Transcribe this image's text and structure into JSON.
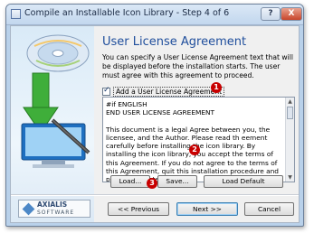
{
  "window": {
    "title": "Compile an Installable Icon Library - Step 4 of 6",
    "help_label": "?",
    "close_label": "X"
  },
  "page": {
    "heading": "User License Agreement",
    "description": "You can specify a User License Agreement text that will be displayed before the installation starts. The user must agree with this agreement to proceed."
  },
  "checkbox": {
    "label": "Add a User License Agreement",
    "checked": true
  },
  "license_text": {
    "lines_top": [
      "#if ENGLISH",
      "END USER LICENSE AGREEMENT"
    ],
    "paragraph1": "This document is a legal Agree between you, the licensee, and the Author. Please read th eement carefully before installing the icon library. By installing the icon library, you accept the terms of this Agreement. If you do not agree to the terms of this Agreement, quit this installation procedure and promptly delete the files."
  },
  "buttons": {
    "load": "Load...",
    "save": "Save...",
    "load_default": "Load Default",
    "previous": "<< Previous",
    "next": "Next >>",
    "cancel": "Cancel"
  },
  "badges": [
    "1",
    "2",
    "3"
  ],
  "branding": {
    "name": "AXIALIS",
    "sub": "SOFTWARE"
  },
  "colors": {
    "heading": "#1f4e9c",
    "badge": "#c80000",
    "window_frame": "#b9d1ea"
  }
}
